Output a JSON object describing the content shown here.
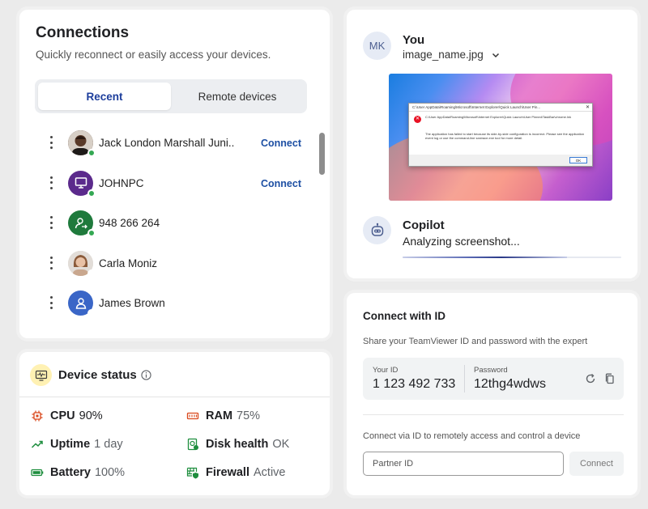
{
  "connections": {
    "title": "Connections",
    "subtitle": "Quickly reconnect or easily access your devices.",
    "tabs": [
      {
        "label": "Recent",
        "active": true
      },
      {
        "label": "Remote devices",
        "active": false
      }
    ],
    "devices": [
      {
        "name": "Jack London Marshall Juni..",
        "connect_label": "Connect",
        "avatar": "photo-man",
        "status": "online"
      },
      {
        "name": "JOHNPC",
        "connect_label": "Connect",
        "avatar": "monitor-icon",
        "status": "online"
      },
      {
        "name": "948 266 264",
        "connect_label": "",
        "avatar": "remote-user-icon",
        "status": "online"
      },
      {
        "name": "Carla Moniz",
        "connect_label": "",
        "avatar": "photo-woman",
        "status": "offline"
      },
      {
        "name": "James Brown",
        "connect_label": "",
        "avatar": "user-icon",
        "status": "offline"
      }
    ]
  },
  "device_status": {
    "title": "Device status",
    "stats": [
      {
        "label": "CPU",
        "value": "90%",
        "icon": "cpu-icon"
      },
      {
        "label": "RAM",
        "value": "75%",
        "icon": "ram-icon"
      },
      {
        "label": "Uptime",
        "value": "1 day",
        "icon": "uptime-icon"
      },
      {
        "label": "Disk health",
        "value": "OK",
        "icon": "disk-health-icon"
      },
      {
        "label": "Battery",
        "value": "100%",
        "icon": "battery-icon"
      },
      {
        "label": "Firewall",
        "value": "Active",
        "icon": "firewall-icon"
      }
    ]
  },
  "copilot_panel": {
    "user_initials": "MK",
    "user_name": "You",
    "attachment_name": "image_name.jpg",
    "screenshot": {
      "dialog_title": "C:\\User                      AppData\\Roaming\\Microsoft\\Internet Explorer\\Quick Launch\\User Pin...",
      "dialog_path": "C:\\User                      AppData\\Roaming\\Microsoft\\Internet Explorer\\Quick Launch\\User Pinned\\TaskBar\\chrome.lnk",
      "dialog_message": "The application has failed to start because its side-by-side configuration is incorrect. Please see the application event log or use the command-line sxstrace.exe tool for more detail.",
      "ok_label": "OK"
    },
    "assistant_name": "Copilot",
    "assistant_status": "Analyzing screenshot...",
    "progress": 0.75
  },
  "connect_with_id": {
    "title": "Connect with ID",
    "share_text": "Share your TeamViewer ID and password with the expert",
    "id_label": "Your ID",
    "id_value": "1 123 492 733",
    "password_label": "Password",
    "password_value": "12thg4wdws",
    "connect_via_text": "Connect via ID to remotely access and control a device",
    "partner_placeholder": "Partner ID",
    "connect_button": "Connect"
  },
  "colors": {
    "accent": "#1d4fa3",
    "online": "#34a853",
    "avatar_purple": "#5b2a8c",
    "avatar_green": "#1f7a3c",
    "avatar_blue": "#3a66c7",
    "icon_red": "#d9481c",
    "icon_green": "#1e8e3e"
  }
}
